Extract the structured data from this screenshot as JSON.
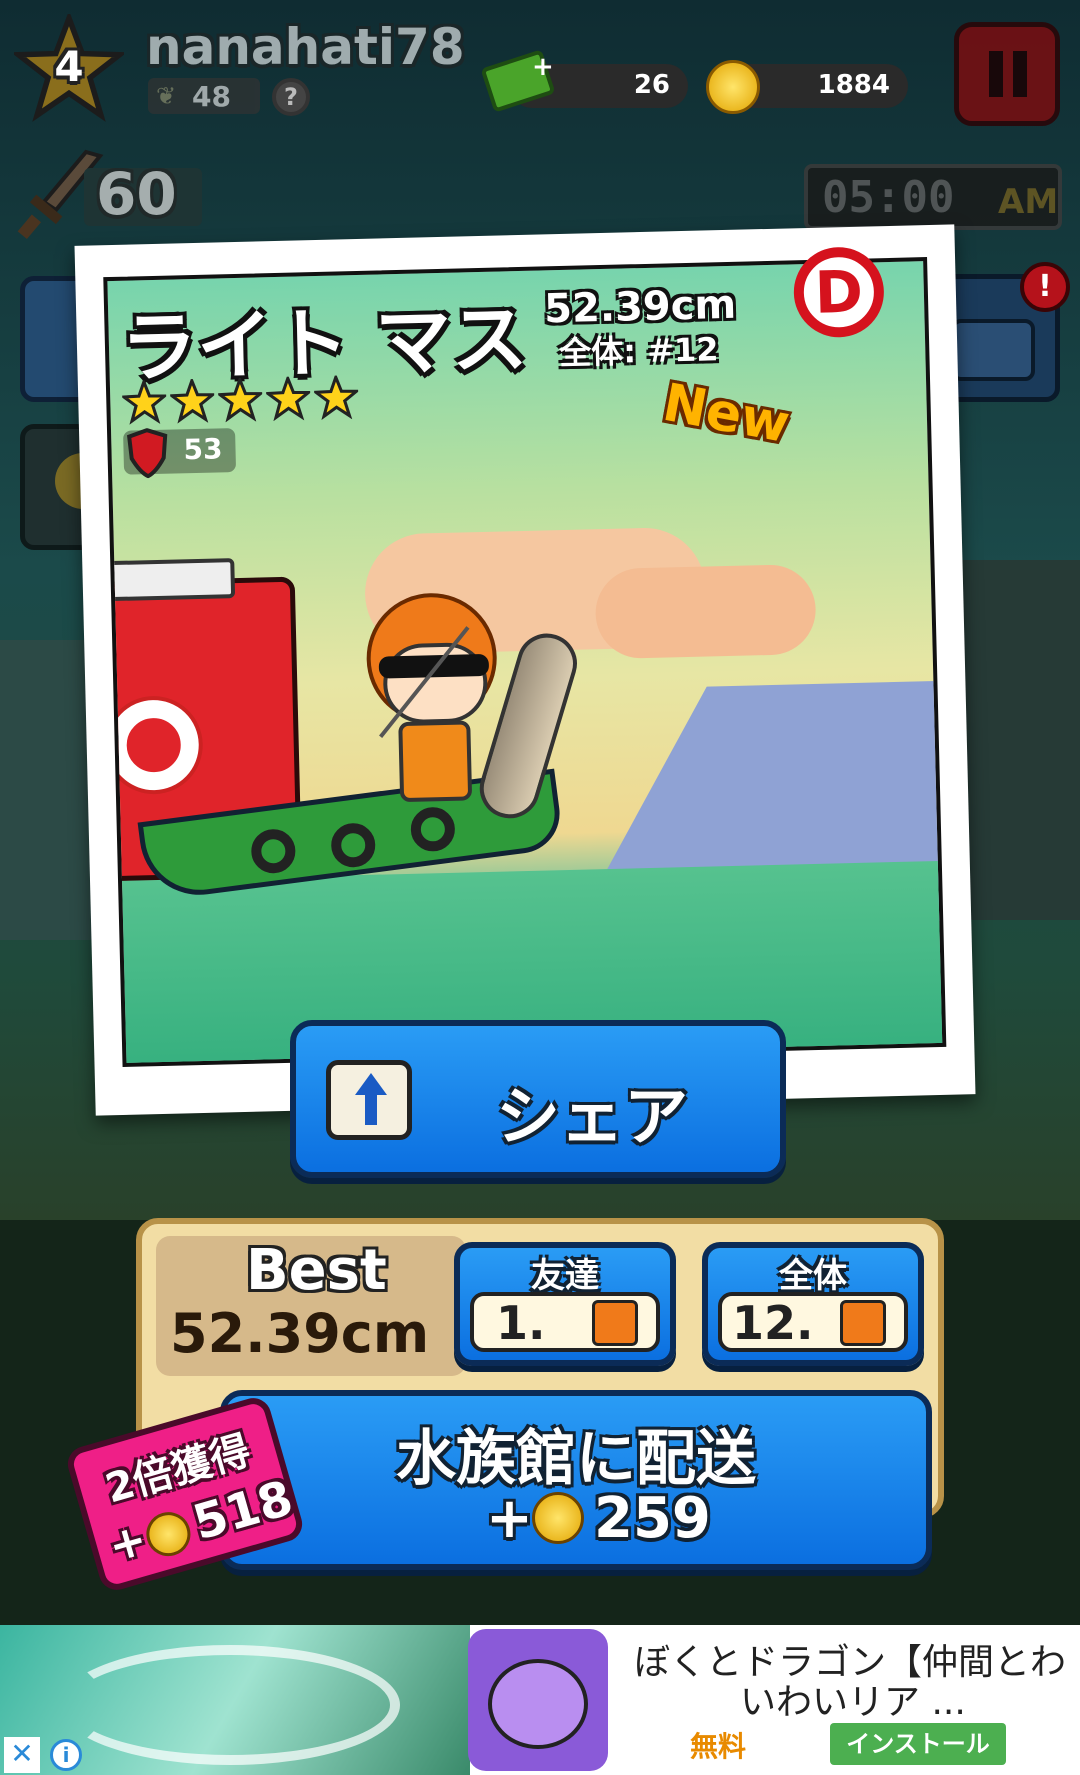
{
  "hud": {
    "level": "4",
    "username": "nanahati78",
    "bait_count": "48",
    "help_symbol": "?",
    "cash_count": "26",
    "coin_count": "1884",
    "power": "60",
    "clock": "05:00",
    "clock_period": "AM",
    "alert_badge": "!"
  },
  "card": {
    "fish_name": "ライト マス",
    "size": "52.39cm",
    "rank": "全体: #12",
    "rank_badge": "D",
    "stars": 5,
    "new_label": "New",
    "defense": "53"
  },
  "share": {
    "label": "シェア"
  },
  "record": {
    "best_label": "Best",
    "best_value": "52.39cm",
    "friends_label": "友達",
    "friends_rank": "1.",
    "overall_label": "全体",
    "overall_rank": "12."
  },
  "deliver": {
    "label": "水族館に配送",
    "plus": "+",
    "reward": "259"
  },
  "double": {
    "label": "2倍獲得",
    "plus": "+",
    "reward": "518"
  },
  "ad": {
    "title_line1": "ぼくとドラゴン【仲間とわ",
    "title_line2": "いわいリア ...",
    "price": "無料",
    "install": "インストール",
    "close": "✕",
    "info": "i"
  },
  "colors": {
    "share_blue": "#0b6fe0",
    "gold_panel": "#e9cf8a",
    "double_pink": "#ef1f87",
    "install_green": "#4caf50",
    "rank_badge_red": "#d5121d"
  }
}
